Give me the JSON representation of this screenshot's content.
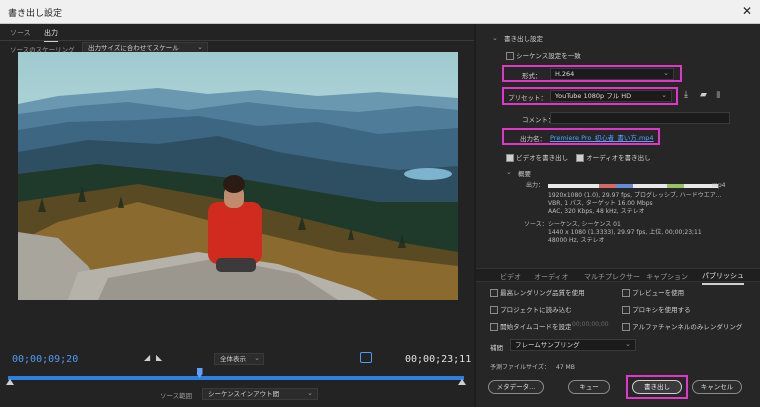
{
  "window": {
    "title": "書き出し設定",
    "close_glyph": "✕"
  },
  "left": {
    "tabs": [
      {
        "label": "ソース"
      },
      {
        "label": "出力"
      }
    ],
    "scaling_label": "ソースのスケーリング",
    "scaling_value": "出力サイズに合わせてスケール",
    "timecode_current": "00;00;09;20",
    "timecode_end": "00;00;23;11",
    "fit_value": "全体表示",
    "source_range_label": "ソース範囲",
    "source_range_value": "シーケンスインアウト間",
    "playhead_fraction": 0.42
  },
  "right": {
    "section_title": "書き出し設定",
    "match_sequence": "シーケンス設定を一致",
    "format_label": "形式：",
    "format_value": "H.264",
    "preset_label": "プリセット：",
    "preset_value": "YouTube 1080p フル HD",
    "comment_label": "コメント：",
    "output_name_label": "出力名：",
    "output_name_value": "Premiere Pro_初心者_書い方.mp4",
    "export_video": "ビデオを書き出し",
    "export_audio": "オーディオを書き出し",
    "summary_title": "概要",
    "output_label": "出力：",
    "output_file_tail": "mp4",
    "output_lines": [
      "1920x1080 (1.0), 29.97 fps, プログレッシブ, ハードウエア...",
      "VBR, 1 パス, ターゲット 16.00 Mbps",
      "AAC, 320 Kbps, 48 kHz, ステレオ"
    ],
    "source_label": "ソース：",
    "source_lines": [
      "シーケンス, シーケンス 01",
      "1440 x 1080 (1.3333), 29.97 fps, 上位, 00;00;23;11",
      "48000 Hz, ステレオ"
    ],
    "tabs": [
      {
        "label": "ビデオ"
      },
      {
        "label": "オーディオ"
      },
      {
        "label": "マルチプレクサー"
      },
      {
        "label": "キャプション"
      },
      {
        "label": "パブリッシュ"
      }
    ],
    "options_left": [
      "最高レンダリング品質を使用",
      "プロジェクトに読み込む",
      "開始タイムコードを設定"
    ],
    "start_tc": "00;00;00;00",
    "options_right": [
      "プレビューを使用",
      "プロキシを使用する",
      "アルファチャンネルのみレンダリング"
    ],
    "interp_label": "補間",
    "interp_value": "フレームサンプリング",
    "filesize_label": "予測ファイルサイズ：",
    "filesize_value": "47 MB",
    "buttons": {
      "metadata": "メタデータ...",
      "queue": "キュー",
      "export": "書き出し",
      "cancel": "キャンセル"
    }
  },
  "colors": {
    "highlight": "#e037c8",
    "accent": "#2f7fdf"
  }
}
